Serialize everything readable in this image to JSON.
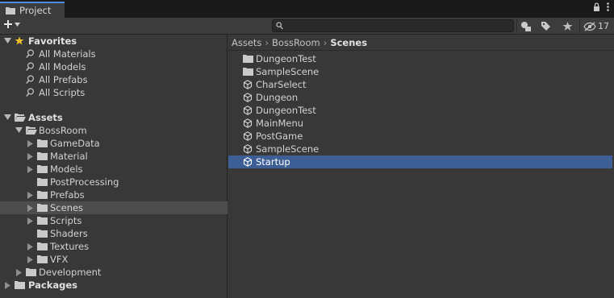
{
  "window": {
    "tab_title": "Project",
    "hidden_count": "17"
  },
  "search": {
    "value": "",
    "placeholder": ""
  },
  "favorites": {
    "title": "Favorites",
    "items": [
      "All Materials",
      "All Models",
      "All Prefabs",
      "All Scripts"
    ]
  },
  "tree": {
    "assets": "Assets",
    "bossroom": "BossRoom",
    "children": [
      "GameData",
      "Material",
      "Models",
      "PostProcessing",
      "Prefabs",
      "Scenes",
      "Scripts",
      "Shaders",
      "Textures",
      "VFX"
    ],
    "development": "Development",
    "packages": "Packages",
    "selected": "Scenes"
  },
  "breadcrumb": [
    "Assets",
    "BossRoom",
    "Scenes"
  ],
  "files": [
    {
      "name": "DungeonTest",
      "kind": "folder"
    },
    {
      "name": "SampleScene",
      "kind": "folder"
    },
    {
      "name": "CharSelect",
      "kind": "scene"
    },
    {
      "name": "Dungeon",
      "kind": "scene"
    },
    {
      "name": "DungeonTest",
      "kind": "scene"
    },
    {
      "name": "MainMenu",
      "kind": "scene"
    },
    {
      "name": "PostGame",
      "kind": "scene"
    },
    {
      "name": "SampleScene",
      "kind": "scene"
    },
    {
      "name": "Startup",
      "kind": "scene"
    }
  ],
  "selected_file": "Startup",
  "colors": {
    "selection": "#3e5f96",
    "tab_accent": "#4d8ce4",
    "star": "#f2c12e"
  }
}
